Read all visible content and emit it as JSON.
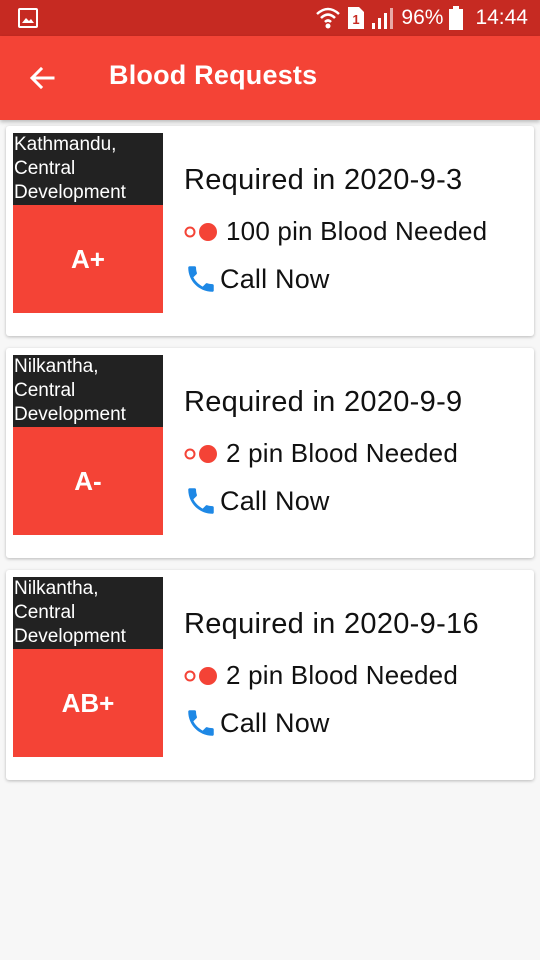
{
  "status_bar": {
    "battery_percent": "96%",
    "time": "14:44",
    "icons": [
      "gallery-icon",
      "wifi-icon",
      "sim-1-icon",
      "signal-icon",
      "battery-icon"
    ]
  },
  "toolbar": {
    "title": "Blood Requests",
    "back_icon": "arrow-left-icon"
  },
  "requests": [
    {
      "location": "Kathmandu, Central Development",
      "blood_group": "A+",
      "required": "Required in 2020-9-3",
      "needed": "100 pin Blood Needed",
      "call_label": "Call Now"
    },
    {
      "location": "Nilkantha, Central Development",
      "blood_group": "A-",
      "required": "Required in 2020-9-9",
      "needed": "2 pin Blood Needed",
      "call_label": "Call Now"
    },
    {
      "location": "Nilkantha, Central Development",
      "blood_group": "AB+",
      "required": "Required in 2020-9-16",
      "needed": "2 pin Blood Needed",
      "call_label": "Call Now"
    }
  ],
  "colors": {
    "status_bar": "#c62a22",
    "toolbar": "#f44336",
    "blood_group_bg": "#f44336",
    "location_bg": "#222222",
    "phone_icon": "#1e88e5",
    "dots": "#f44336"
  }
}
